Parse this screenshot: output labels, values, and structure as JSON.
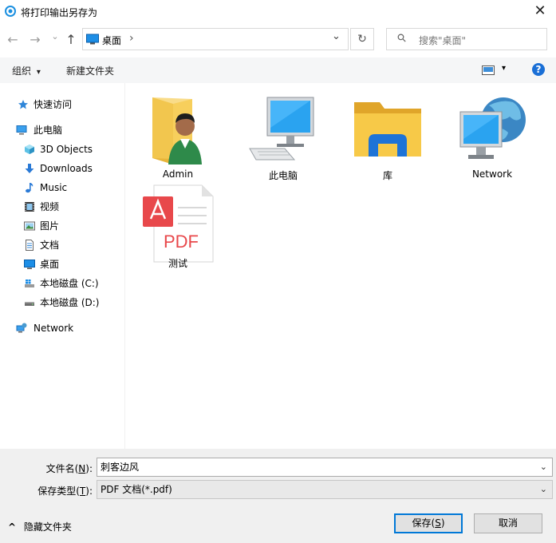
{
  "window": {
    "title": "将打印输出另存为",
    "close_glyph": "✕"
  },
  "nav": {
    "back_glyph": "←",
    "forward_glyph": "→",
    "recent_glyph": "⌄",
    "up_glyph": "↑",
    "address_location": "桌面",
    "address_sep": "›",
    "address_dropdown": "⌄",
    "refresh_glyph": "↻",
    "search_placeholder": "搜索\"桌面\"",
    "search_glyph": "⚲"
  },
  "toolbar": {
    "organize_label": "组织",
    "organize_arrow": "▾",
    "new_folder_label": "新建文件夹",
    "view_arrow": "▾",
    "help_glyph": "?"
  },
  "sidebar": {
    "quick_access": "快速访问",
    "this_pc": "此电脑",
    "items": [
      {
        "label": "3D Objects"
      },
      {
        "label": "Downloads"
      },
      {
        "label": "Music"
      },
      {
        "label": "视频"
      },
      {
        "label": "图片"
      },
      {
        "label": "文档"
      },
      {
        "label": "桌面"
      },
      {
        "label": "本地磁盘 (C:)"
      },
      {
        "label": "本地磁盘 (D:)"
      }
    ],
    "network": "Network"
  },
  "content": {
    "items": [
      {
        "label": "Admin",
        "icon": "user-folder-icon"
      },
      {
        "label": "此电脑",
        "icon": "computer-icon"
      },
      {
        "label": "库",
        "icon": "library-folder-icon"
      },
      {
        "label": "Network",
        "icon": "network-globe-icon"
      },
      {
        "label": "测试",
        "icon": "pdf-file-icon",
        "badge": "PDF"
      }
    ]
  },
  "form": {
    "filename_label": "文件名(",
    "filename_key": "N",
    "filename_label_end": "):",
    "filename_value": "刺客边风",
    "type_label": "保存类型(",
    "type_key": "T",
    "type_label_end": "):",
    "type_value": "PDF 文档(*.pdf)",
    "dropdown_glyph": "⌄"
  },
  "footer": {
    "hide_folders_glyph": "^",
    "hide_folders": "隐藏文件夹",
    "save_label": "保存(",
    "save_key": "S",
    "save_label_end": ")",
    "cancel_label": "取消"
  },
  "colors": {
    "accent": "#0078d7",
    "folder": "#f5c342",
    "pdf": "#e8484b"
  }
}
